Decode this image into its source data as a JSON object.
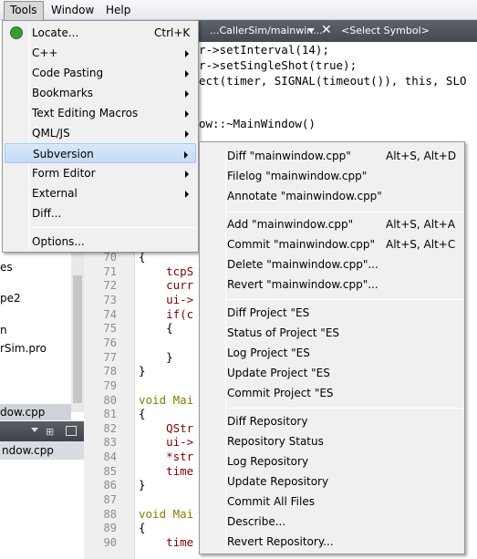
{
  "menubar": {
    "tools": "Tools",
    "window": "Window",
    "help": "Help"
  },
  "editor": {
    "tab_label": "...CallerSim/mainwin...",
    "symbol_select": "<Select Symbol>",
    "code_top": [
      "r->setInterval(14);",
      "r->setSingleShot(true);",
      "ect(timer, SIGNAL(timeout()), this, SLO",
      "ow::~MainWindow()"
    ],
    "line_numbers": [
      "70",
      "71",
      "72",
      "73",
      "74",
      "75",
      "76",
      "77",
      "78",
      "79",
      "80",
      "81",
      "82",
      "83",
      "84",
      "85",
      "86",
      "87",
      "88",
      "89",
      "90"
    ],
    "code_lines": [
      "{",
      "    tcpS",
      "    curr",
      "    ui->",
      "    if(c",
      "    {",
      "",
      "    }",
      "}",
      "",
      "void Mai",
      "{",
      "    QStr",
      "    ui->",
      "    *str",
      "    time",
      "}",
      "",
      "void Mai",
      "{",
      "    time"
    ]
  },
  "project_panel": {
    "items": [
      "es",
      "pe2",
      "n",
      "rSim.pro"
    ],
    "selected_file": "dow.cpp",
    "bottom_file": "ndow.cpp"
  },
  "tools_menu": {
    "items": [
      {
        "label": "Locate...",
        "shortcut": "Ctrl+K",
        "submenu": false
      },
      {
        "label": "C++",
        "submenu": true
      },
      {
        "label": "Code Pasting",
        "submenu": true
      },
      {
        "label": "Bookmarks",
        "submenu": true
      },
      {
        "label": "Text Editing Macros",
        "submenu": true
      },
      {
        "label": "QML/JS",
        "submenu": true
      },
      {
        "label": "Subversion",
        "submenu": true,
        "highlighted": true
      },
      {
        "label": "Form Editor",
        "submenu": true
      },
      {
        "label": "External",
        "submenu": true
      },
      {
        "label": "Diff...",
        "submenu": false
      },
      {
        "label": "Options...",
        "submenu": false
      }
    ]
  },
  "subversion_menu": {
    "groups": [
      [
        {
          "label": "Diff \"mainwindow.cpp\"",
          "shortcut": "Alt+S, Alt+D"
        },
        {
          "label": "Filelog \"mainwindow.cpp\""
        },
        {
          "label": "Annotate \"mainwindow.cpp\""
        }
      ],
      [
        {
          "label": "Add \"mainwindow.cpp\"",
          "shortcut": "Alt+S, Alt+A"
        },
        {
          "label": "Commit \"mainwindow.cpp\"",
          "shortcut": "Alt+S, Alt+C"
        },
        {
          "label": "Delete \"mainwindow.cpp\"..."
        },
        {
          "label": "Revert \"mainwindow.cpp\"..."
        }
      ],
      [
        {
          "label": "Diff Project \"ES"
        },
        {
          "label": "Status of Project \"ES"
        },
        {
          "label": "Log Project \"ES"
        },
        {
          "label": "Update Project \"ES"
        },
        {
          "label": "Commit Project \"ES"
        }
      ],
      [
        {
          "label": "Diff Repository"
        },
        {
          "label": "Repository Status"
        },
        {
          "label": "Log Repository"
        },
        {
          "label": "Update Repository"
        },
        {
          "label": "Commit All Files"
        },
        {
          "label": "Describe..."
        },
        {
          "label": "Revert Repository..."
        }
      ]
    ]
  },
  "colors": {
    "highlight": "#c3daf5",
    "keyword": "#808000",
    "member": "#800000",
    "string": "#008000"
  }
}
